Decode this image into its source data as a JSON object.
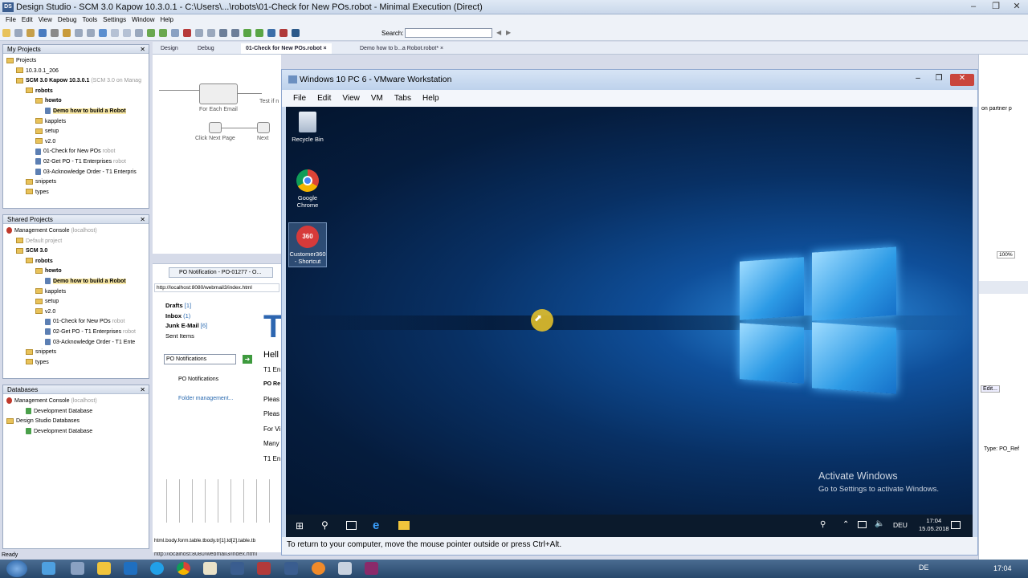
{
  "app": {
    "logo": "DS",
    "title": "Design Studio - SCM 3.0 Kapow 10.3.0.1 - C:\\Users\\...\\robots\\01-Check for New POs.robot - Minimal Execution (Direct)"
  },
  "menu": [
    "File",
    "Edit",
    "View",
    "Debug",
    "Tools",
    "Settings",
    "Window",
    "Help"
  ],
  "toolbar": {
    "search_label": "Search:",
    "search_value": ""
  },
  "my_projects": {
    "title": "My Projects",
    "items": [
      {
        "label": "Projects",
        "depth": 0,
        "kind": "folder"
      },
      {
        "label": "10.3.0.1_206",
        "depth": 1,
        "kind": "folder"
      },
      {
        "label": "SCM 3.0 Kapow 10.3.0.1",
        "extra": "(SCM 3.0 on Manag",
        "depth": 1,
        "kind": "folder",
        "bold": true
      },
      {
        "label": "robots",
        "depth": 2,
        "kind": "folder",
        "bold": true
      },
      {
        "label": "howto",
        "depth": 3,
        "kind": "folder",
        "bold": true
      },
      {
        "label": "Demo how to build a Robot",
        "depth": 4,
        "kind": "robot",
        "bold": true,
        "selected": true
      },
      {
        "label": "kapplets",
        "depth": 3,
        "kind": "folder"
      },
      {
        "label": "setup",
        "depth": 3,
        "kind": "folder"
      },
      {
        "label": "v2.0",
        "depth": 3,
        "kind": "folder"
      },
      {
        "label": "01-Check for New POs",
        "extra": "robot",
        "depth": 3,
        "kind": "robot"
      },
      {
        "label": "02-Get PO - T1 Enterprises",
        "extra": "robot",
        "depth": 3,
        "kind": "robot"
      },
      {
        "label": "03-Acknowledge Order - T1 Enterpris",
        "depth": 3,
        "kind": "robot"
      },
      {
        "label": "snippets",
        "depth": 2,
        "kind": "folder"
      },
      {
        "label": "types",
        "depth": 2,
        "kind": "folder"
      }
    ]
  },
  "shared_projects": {
    "title": "Shared Projects",
    "items": [
      {
        "label": "Management Console",
        "extra": "(localhost)",
        "depth": 0,
        "kind": "mc"
      },
      {
        "label": "Default project",
        "depth": 1,
        "kind": "folder",
        "grey": true
      },
      {
        "label": "SCM 3.0",
        "depth": 1,
        "kind": "folder",
        "bold": true
      },
      {
        "label": "robots",
        "depth": 2,
        "kind": "folder",
        "bold": true
      },
      {
        "label": "howto",
        "depth": 3,
        "kind": "folder",
        "bold": true
      },
      {
        "label": "Demo how to build a Robot",
        "depth": 4,
        "kind": "robot",
        "bold": true,
        "selected": true
      },
      {
        "label": "kapplets",
        "depth": 3,
        "kind": "folder"
      },
      {
        "label": "setup",
        "depth": 3,
        "kind": "folder"
      },
      {
        "label": "v2.0",
        "depth": 3,
        "kind": "folder"
      },
      {
        "label": "01-Check for New POs",
        "extra": "robot",
        "depth": 4,
        "kind": "robot"
      },
      {
        "label": "02-Get PO - T1 Enterprises",
        "extra": "robot",
        "depth": 4,
        "kind": "robot"
      },
      {
        "label": "03-Acknowledge Order - T1 Ente",
        "depth": 4,
        "kind": "robot"
      },
      {
        "label": "snippets",
        "depth": 2,
        "kind": "folder"
      },
      {
        "label": "types",
        "depth": 2,
        "kind": "folder"
      }
    ]
  },
  "databases": {
    "title": "Databases",
    "items": [
      {
        "label": "Management Console",
        "extra": "(localhost)",
        "depth": 0,
        "kind": "mc"
      },
      {
        "label": "Development Database",
        "depth": 2,
        "kind": "db"
      },
      {
        "label": "Design Studio Databases",
        "depth": 0,
        "kind": "folder"
      },
      {
        "label": "Development Database",
        "depth": 2,
        "kind": "db"
      }
    ]
  },
  "status": {
    "left": "Ready",
    "url": "http://localhost:8080/webmail3/index.html"
  },
  "editor_tabs": [
    {
      "label": "Design"
    },
    {
      "label": "Debug"
    },
    {
      "label": "01-Check for New POs.robot",
      "active": true
    },
    {
      "label": "Demo how to b...a Robot.robot*"
    }
  ],
  "flow": {
    "nodes": [
      "For Each Email",
      "Click Next Page",
      "Next",
      "Test if n"
    ]
  },
  "browser": {
    "tab": "PO Notification - PO-01277 - O...",
    "url": "http://localhost:8080/webmail3/index.html",
    "folders": [
      {
        "name": "Drafts",
        "count": "[1]"
      },
      {
        "name": "Inbox",
        "count": "(1)"
      },
      {
        "name": "Junk E-Mail",
        "count": "[6]"
      },
      {
        "name": "Sent Items",
        "count": ""
      }
    ],
    "dropdown": "PO Notifications",
    "po_folder": "PO Notifications",
    "folder_mgmt": "Folder management...",
    "body_lines": [
      "T",
      "Hell",
      "T1 En",
      "PO Re",
      "Pleas",
      "Pleas",
      "For Vi",
      "Many",
      "T1 En"
    ],
    "xpath": "html.body.form.table.tbody.tr[1].td[2].table.tb"
  },
  "right_panel": {
    "partner": "on partner p",
    "zoom": "100%",
    "edit": "Edit...",
    "type": "Type: PO_Ref"
  },
  "vmware": {
    "title": "Windows 10 PC 6 - VMware Workstation",
    "menu": [
      "File",
      "Edit",
      "View",
      "VM",
      "Tabs",
      "Help"
    ],
    "status": "To return to your computer, move the mouse pointer outside or press Ctrl+Alt."
  },
  "desktop": {
    "icons": [
      "Recycle Bin",
      "Google Chrome",
      "Customer360 - Shortcut"
    ],
    "activate_title": "Activate Windows",
    "activate_sub": "Go to Settings to activate Windows.",
    "tray": {
      "lang": "DEU",
      "time": "17:04",
      "date": "15.05.2018"
    }
  },
  "host_taskbar": {
    "lang": "DE",
    "time": "17:04",
    "apps": [
      "ie",
      "media",
      "folder",
      "outlook",
      "skype",
      "chrome",
      "st",
      "ds",
      "ds2",
      "ds3",
      "ds4",
      "vmware",
      "files",
      "tool"
    ]
  }
}
